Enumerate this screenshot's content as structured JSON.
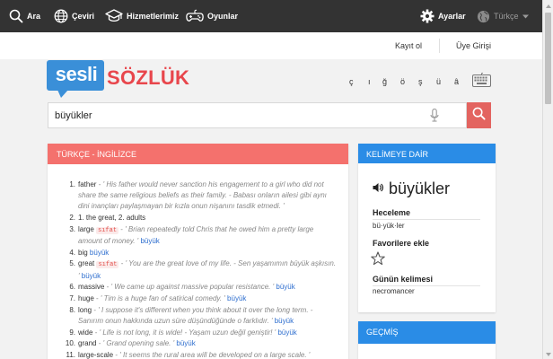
{
  "topbar": {
    "search_label": "Ara",
    "translate_label": "Çeviri",
    "services_label": "Hizmetlerimiz",
    "games_label": "Oyunlar",
    "settings_label": "Ayarlar",
    "language_label": "Türkçe"
  },
  "auth": {
    "register_label": "Kayıt ol",
    "login_label": "Üye Girişi"
  },
  "logo": {
    "sesli": "sesli",
    "sozluk": "SÖZLÜK"
  },
  "special_chars": [
    "ç",
    "ı",
    "ğ",
    "ö",
    "ş",
    "ü",
    "â"
  ],
  "search": {
    "value": "büyükler"
  },
  "main": {
    "title": "TÜRKÇE - İNGİLİZCE",
    "definitions": [
      {
        "num": "1.",
        "word": "father",
        "example": "' His father would never sanction his engagement to a girl who did not share the same religious beliefs as their family. - Babası onların ailesi gibi aynı dini inançları paylaşmayan bir kızla onun nişanını tasdik etmedi. '"
      },
      {
        "num": "2.",
        "word": "1. the great, 2. adults"
      },
      {
        "num": "3.",
        "word": "large",
        "tag": "sıfat",
        "example": "' Brian repeatedly told Chris that he owed him a pretty large amount of money. '",
        "link": "büyük"
      },
      {
        "num": "4.",
        "word": "big",
        "link": "büyük"
      },
      {
        "num": "5.",
        "word": "great",
        "tag": "sıfat",
        "example": "' You are the great love of my life. - Sen yaşamımın büyük aşkısın. '",
        "link": "büyük"
      },
      {
        "num": "6.",
        "word": "massive",
        "example": "' We came up against massive popular resistance. '",
        "link": "büyük"
      },
      {
        "num": "7.",
        "word": "huge",
        "example": "' Tim is a huge fan of satirical comedy. '",
        "link": "büyük"
      },
      {
        "num": "8.",
        "word": "long",
        "example": "' I suppose it's different when you think about it over the long term. - Sanırım onun hakkında uzun süre düşündüğünde o farklıdır. '",
        "link": "büyük"
      },
      {
        "num": "9.",
        "word": "wide",
        "example": "' Life is not long, it is wide! - Yaşam uzun değil geniştir! '",
        "link": "büyük"
      },
      {
        "num": "10.",
        "word": "grand",
        "example": "' Grand opening sale. '",
        "link": "büyük"
      },
      {
        "num": "11.",
        "word": "large-scale",
        "example": "' It seems the rural area will be developed on a large scale. '"
      }
    ]
  },
  "side": {
    "title": "KELİMEYE DAİR",
    "word": "büyükler",
    "spelling_title": "Heceleme",
    "spelling_value": "bü·yük·ler",
    "favorites_title": "Favorilere ekle",
    "wotd_title": "Günün kelimesi",
    "wotd_value": "necromancer"
  },
  "history": {
    "title": "GEÇMİŞ"
  },
  "colors": {
    "topbar": "#333333",
    "brand_blue": "#3a8fd8",
    "brand_red": "#e8464c",
    "main_header": "#f4716d",
    "side_header": "#2a8ce6",
    "link": "#2f6fcf"
  }
}
